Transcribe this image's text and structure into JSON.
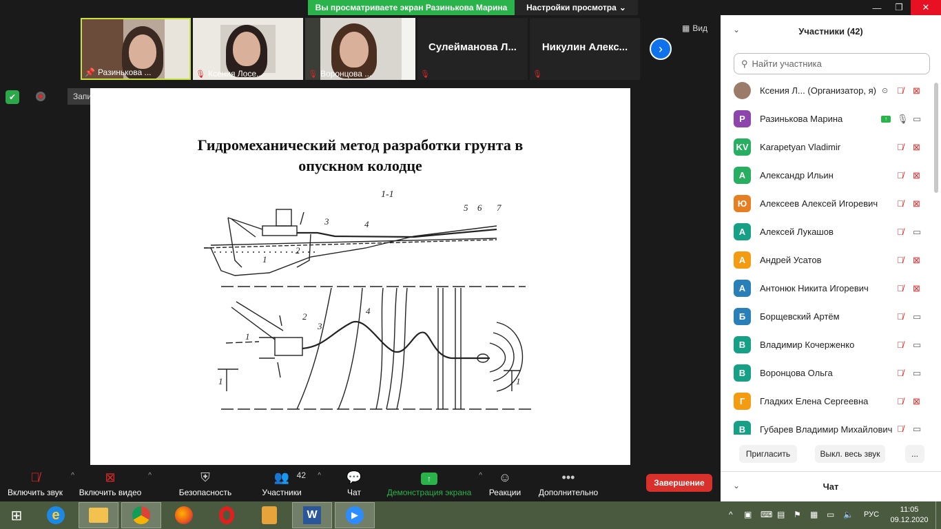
{
  "banner": {
    "share_text": "Вы просматриваете экран Разинькова Марина",
    "view_settings": "Настройки просмотра"
  },
  "strip": {
    "tiles": [
      {
        "name": "Разинькова ..."
      },
      {
        "name": "Ксения Лосе..."
      },
      {
        "name": "Воронцова ..."
      },
      {
        "name": "Сулейманова Л..."
      },
      {
        "name": "Никулин Алекс..."
      }
    ],
    "view_label": "Вид"
  },
  "recording": {
    "label": "Запись..."
  },
  "slide": {
    "title_line1": "Гидромеханический метод разработки грунта в",
    "title_line2": "опускном колодце",
    "section_label": "1-1",
    "labels": [
      "1",
      "2",
      "3",
      "4",
      "5",
      "6",
      "7",
      "1",
      "2",
      "3",
      "4",
      "1",
      "1"
    ]
  },
  "panel": {
    "title": "Участники (42)",
    "search_placeholder": "Найти участника",
    "participants": [
      {
        "initial": "",
        "name": "Ксения Л...  (Организатор, я)",
        "color": "#8a6a5a",
        "mic": "muted",
        "cam": "off"
      },
      {
        "initial": "Р",
        "name": "Разинькова Марина",
        "color": "#8e44ad",
        "mic": "on",
        "cam": "on"
      },
      {
        "initial": "KV",
        "name": "Karapetyan Vladimir",
        "color": "#27ae60",
        "mic": "muted",
        "cam": "off"
      },
      {
        "initial": "А",
        "name": "Александр Ильин",
        "color": "#27ae60",
        "mic": "muted",
        "cam": "off"
      },
      {
        "initial": "Ю",
        "name": "Алексеев Алексей Игоревич",
        "color": "#e67e22",
        "mic": "muted",
        "cam": "off"
      },
      {
        "initial": "А",
        "name": "Алексей Лукашов",
        "color": "#16a085",
        "mic": "muted",
        "cam": "on"
      },
      {
        "initial": "А",
        "name": "Андрей Усатов",
        "color": "#f39c12",
        "mic": "muted",
        "cam": "off"
      },
      {
        "initial": "А",
        "name": "Антонюк Никита Игоревич",
        "color": "#2980b9",
        "mic": "muted",
        "cam": "off"
      },
      {
        "initial": "Б",
        "name": "Борщевский Артём",
        "color": "#2980b9",
        "mic": "muted",
        "cam": "on"
      },
      {
        "initial": "В",
        "name": "Владимир Кочерженко",
        "color": "#16a085",
        "mic": "muted",
        "cam": "on"
      },
      {
        "initial": "В",
        "name": "Воронцова Ольга",
        "color": "#16a085",
        "mic": "muted",
        "cam": "on"
      },
      {
        "initial": "Г",
        "name": "Гладких Елена Сергеевна",
        "color": "#f39c12",
        "mic": "muted",
        "cam": "off"
      },
      {
        "initial": "В",
        "name": "Губарев Владимир Михайлович",
        "color": "#16a085",
        "mic": "muted",
        "cam": "on"
      }
    ],
    "invite": "Пригласить",
    "mute_all": "Выкл. весь звук",
    "more": "...",
    "chat_title": "Чат"
  },
  "toolbar": {
    "audio": "Включить звук",
    "video": "Включить видео",
    "security": "Безопасность",
    "participants": "Участники",
    "participants_count": "42",
    "chat": "Чат",
    "share": "Демонстрация экрана",
    "reactions": "Реакции",
    "more": "Дополнительно",
    "end": "Завершение"
  },
  "taskbar": {
    "lang": "РУС",
    "time": "11:05",
    "date": "09.12.2020"
  },
  "colors": {
    "accent_blue": "#0e72ed",
    "share_green": "#2ab34a",
    "end_red": "#d8302a"
  }
}
